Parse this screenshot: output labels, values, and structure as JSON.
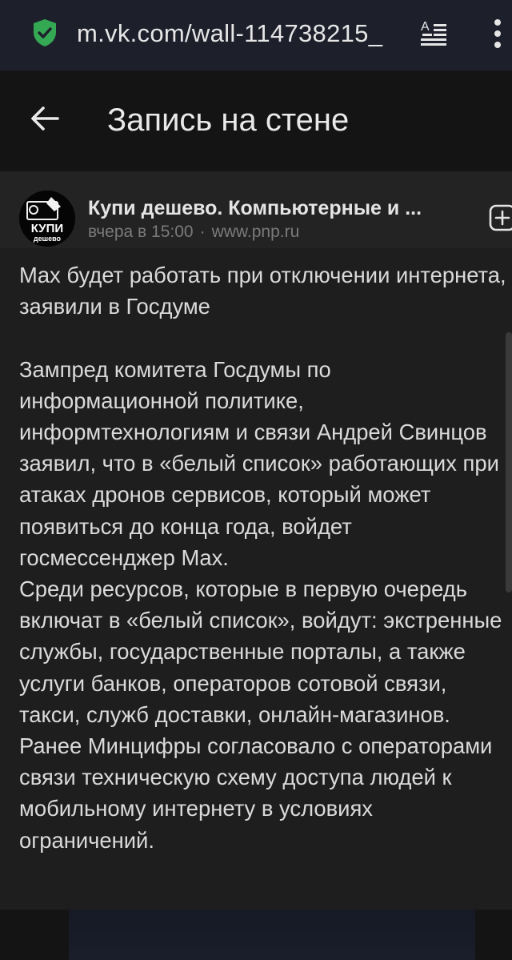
{
  "browser": {
    "url": "m.vk.com/wall-114738215_"
  },
  "header": {
    "title": "Запись на стене"
  },
  "post": {
    "author": "Купи дешево. Компьютерные и ...",
    "time": "вчера в 15:00",
    "source": "www.pnp.ru",
    "avatar_text": "КУПИ дешево",
    "paragraphs": [
      "Max будет работать при отключении интернета, заявили в Госдуме",
      "",
      "Зампред комитета Госдумы по информационной политике, информтехнологиям и связи Андрей Свинцов заявил, что в «белый список» работающих при атаках дронов сервисов, который может появиться до конца года, войдет госмессенджер Max.",
      "Среди ресурсов, которые в первую очередь включат в «белый список», войдут: экстренные службы, государственные порталы, а также услуги банков, операторов сотовой связи, такси, служб доставки, онлайн-магазинов.",
      "Ранее Минцифры согласовало с операторами связи техническую схему доступа людей к мобильному интернету в условиях ограничений."
    ]
  },
  "colors": {
    "browser_bar": "#1d1f2b",
    "background": "#141414",
    "card": "#1e1e1e",
    "text": "#dadada",
    "secure_icon": "#34a853"
  }
}
